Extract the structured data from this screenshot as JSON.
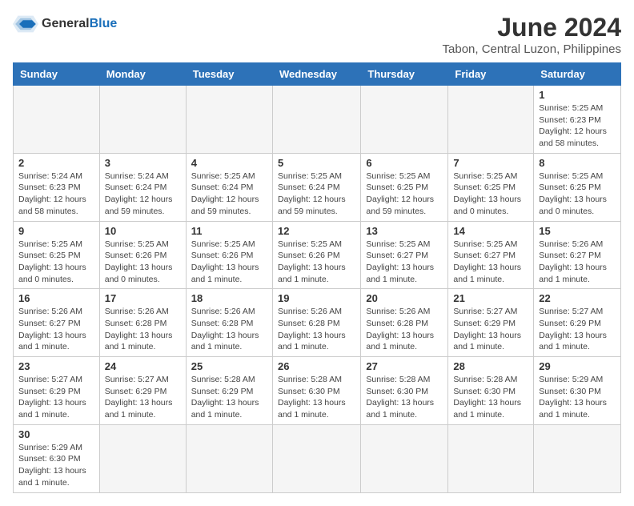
{
  "logo": {
    "text_general": "General",
    "text_blue": "Blue"
  },
  "title": "June 2024",
  "subtitle": "Tabon, Central Luzon, Philippines",
  "weekdays": [
    "Sunday",
    "Monday",
    "Tuesday",
    "Wednesday",
    "Thursday",
    "Friday",
    "Saturday"
  ],
  "weeks": [
    [
      {
        "day": "",
        "info": ""
      },
      {
        "day": "",
        "info": ""
      },
      {
        "day": "",
        "info": ""
      },
      {
        "day": "",
        "info": ""
      },
      {
        "day": "",
        "info": ""
      },
      {
        "day": "",
        "info": ""
      },
      {
        "day": "1",
        "info": "Sunrise: 5:25 AM\nSunset: 6:23 PM\nDaylight: 12 hours\nand 58 minutes."
      }
    ],
    [
      {
        "day": "2",
        "info": "Sunrise: 5:24 AM\nSunset: 6:23 PM\nDaylight: 12 hours\nand 58 minutes."
      },
      {
        "day": "3",
        "info": "Sunrise: 5:24 AM\nSunset: 6:24 PM\nDaylight: 12 hours\nand 59 minutes."
      },
      {
        "day": "4",
        "info": "Sunrise: 5:25 AM\nSunset: 6:24 PM\nDaylight: 12 hours\nand 59 minutes."
      },
      {
        "day": "5",
        "info": "Sunrise: 5:25 AM\nSunset: 6:24 PM\nDaylight: 12 hours\nand 59 minutes."
      },
      {
        "day": "6",
        "info": "Sunrise: 5:25 AM\nSunset: 6:25 PM\nDaylight: 12 hours\nand 59 minutes."
      },
      {
        "day": "7",
        "info": "Sunrise: 5:25 AM\nSunset: 6:25 PM\nDaylight: 13 hours\nand 0 minutes."
      },
      {
        "day": "8",
        "info": "Sunrise: 5:25 AM\nSunset: 6:25 PM\nDaylight: 13 hours\nand 0 minutes."
      }
    ],
    [
      {
        "day": "9",
        "info": "Sunrise: 5:25 AM\nSunset: 6:25 PM\nDaylight: 13 hours\nand 0 minutes."
      },
      {
        "day": "10",
        "info": "Sunrise: 5:25 AM\nSunset: 6:26 PM\nDaylight: 13 hours\nand 0 minutes."
      },
      {
        "day": "11",
        "info": "Sunrise: 5:25 AM\nSunset: 6:26 PM\nDaylight: 13 hours\nand 1 minute."
      },
      {
        "day": "12",
        "info": "Sunrise: 5:25 AM\nSunset: 6:26 PM\nDaylight: 13 hours\nand 1 minute."
      },
      {
        "day": "13",
        "info": "Sunrise: 5:25 AM\nSunset: 6:27 PM\nDaylight: 13 hours\nand 1 minute."
      },
      {
        "day": "14",
        "info": "Sunrise: 5:25 AM\nSunset: 6:27 PM\nDaylight: 13 hours\nand 1 minute."
      },
      {
        "day": "15",
        "info": "Sunrise: 5:26 AM\nSunset: 6:27 PM\nDaylight: 13 hours\nand 1 minute."
      }
    ],
    [
      {
        "day": "16",
        "info": "Sunrise: 5:26 AM\nSunset: 6:27 PM\nDaylight: 13 hours\nand 1 minute."
      },
      {
        "day": "17",
        "info": "Sunrise: 5:26 AM\nSunset: 6:28 PM\nDaylight: 13 hours\nand 1 minute."
      },
      {
        "day": "18",
        "info": "Sunrise: 5:26 AM\nSunset: 6:28 PM\nDaylight: 13 hours\nand 1 minute."
      },
      {
        "day": "19",
        "info": "Sunrise: 5:26 AM\nSunset: 6:28 PM\nDaylight: 13 hours\nand 1 minute."
      },
      {
        "day": "20",
        "info": "Sunrise: 5:26 AM\nSunset: 6:28 PM\nDaylight: 13 hours\nand 1 minute."
      },
      {
        "day": "21",
        "info": "Sunrise: 5:27 AM\nSunset: 6:29 PM\nDaylight: 13 hours\nand 1 minute."
      },
      {
        "day": "22",
        "info": "Sunrise: 5:27 AM\nSunset: 6:29 PM\nDaylight: 13 hours\nand 1 minute."
      }
    ],
    [
      {
        "day": "23",
        "info": "Sunrise: 5:27 AM\nSunset: 6:29 PM\nDaylight: 13 hours\nand 1 minute."
      },
      {
        "day": "24",
        "info": "Sunrise: 5:27 AM\nSunset: 6:29 PM\nDaylight: 13 hours\nand 1 minute."
      },
      {
        "day": "25",
        "info": "Sunrise: 5:28 AM\nSunset: 6:29 PM\nDaylight: 13 hours\nand 1 minute."
      },
      {
        "day": "26",
        "info": "Sunrise: 5:28 AM\nSunset: 6:30 PM\nDaylight: 13 hours\nand 1 minute."
      },
      {
        "day": "27",
        "info": "Sunrise: 5:28 AM\nSunset: 6:30 PM\nDaylight: 13 hours\nand 1 minute."
      },
      {
        "day": "28",
        "info": "Sunrise: 5:28 AM\nSunset: 6:30 PM\nDaylight: 13 hours\nand 1 minute."
      },
      {
        "day": "29",
        "info": "Sunrise: 5:29 AM\nSunset: 6:30 PM\nDaylight: 13 hours\nand 1 minute."
      }
    ],
    [
      {
        "day": "30",
        "info": "Sunrise: 5:29 AM\nSunset: 6:30 PM\nDaylight: 13 hours\nand 1 minute."
      },
      {
        "day": "",
        "info": ""
      },
      {
        "day": "",
        "info": ""
      },
      {
        "day": "",
        "info": ""
      },
      {
        "day": "",
        "info": ""
      },
      {
        "day": "",
        "info": ""
      },
      {
        "day": "",
        "info": ""
      }
    ]
  ]
}
